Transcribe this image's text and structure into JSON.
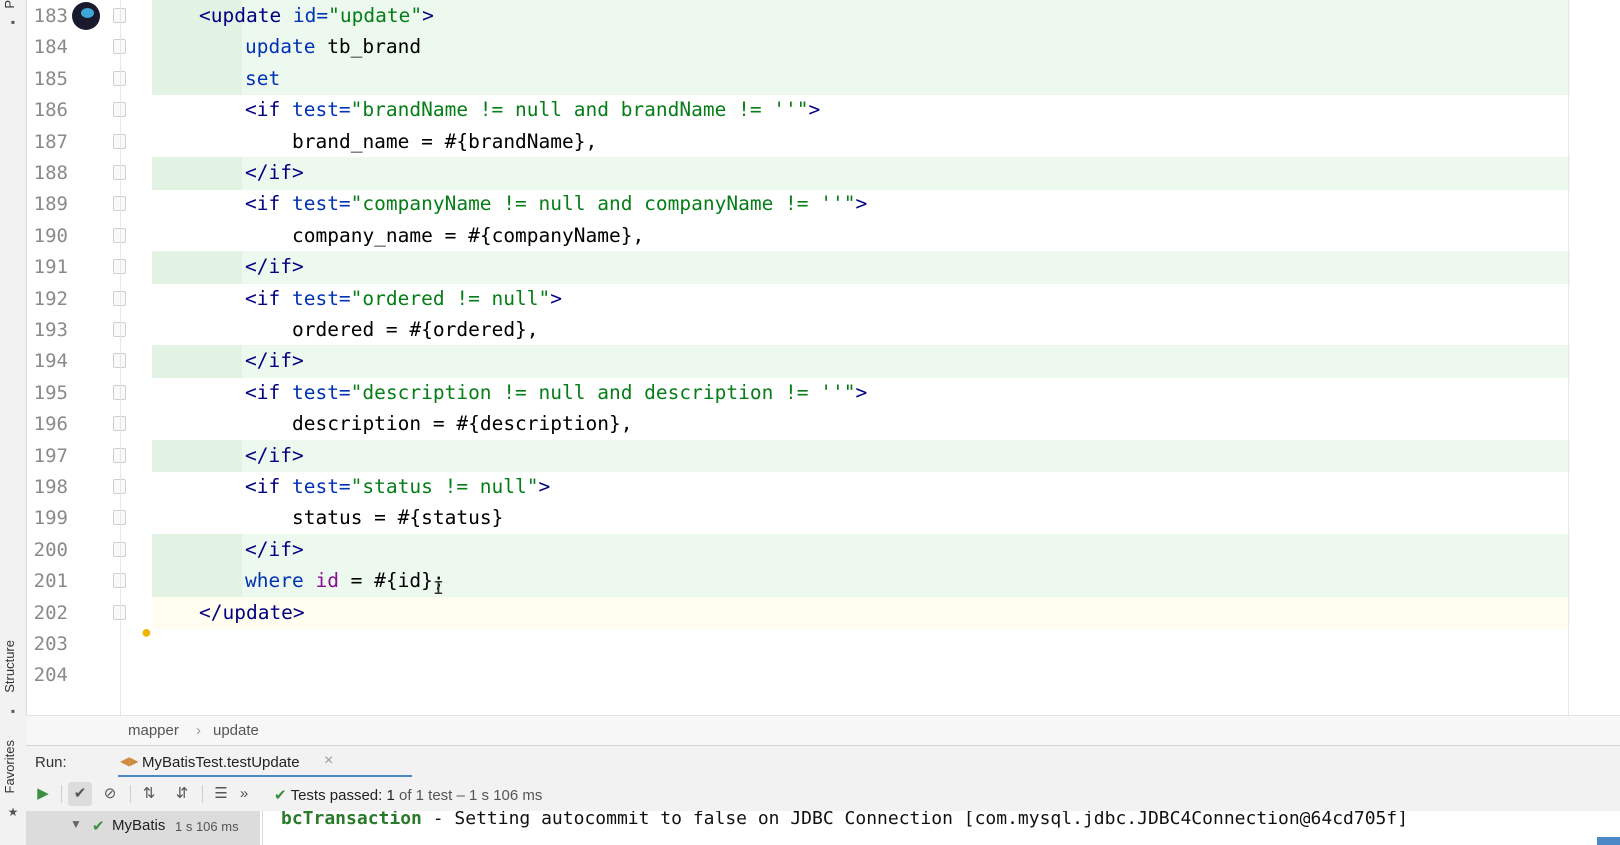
{
  "side": {
    "top_label": "P",
    "structure_label": "Structure",
    "favorites_label": "Favorites"
  },
  "editor": {
    "lines": [
      {
        "num": "183",
        "indent": 1,
        "tokens": [
          [
            "tag",
            "<update "
          ],
          [
            "attr",
            "id="
          ],
          [
            "str",
            "\"update\""
          ],
          [
            "tag",
            ">"
          ]
        ]
      },
      {
        "num": "184",
        "indent": 2,
        "tokens": [
          [
            "kw",
            "update"
          ],
          [
            "plain",
            " tb_brand"
          ]
        ]
      },
      {
        "num": "185",
        "indent": 2,
        "tokens": [
          [
            "kw",
            "set"
          ]
        ]
      },
      {
        "num": "186",
        "indent": 2,
        "tokens": [
          [
            "tag",
            "<if "
          ],
          [
            "attr",
            "test="
          ],
          [
            "str",
            "\"brandName != null and brandName != ''\""
          ],
          [
            "tag",
            ">"
          ]
        ]
      },
      {
        "num": "187",
        "indent": 3,
        "tokens": [
          [
            "plain",
            "brand_name = #{brandName},"
          ]
        ]
      },
      {
        "num": "188",
        "indent": 2,
        "tokens": [
          [
            "tag",
            "</if>"
          ]
        ]
      },
      {
        "num": "189",
        "indent": 2,
        "tokens": [
          [
            "tag",
            "<if "
          ],
          [
            "attr",
            "test="
          ],
          [
            "str",
            "\"companyName != null and companyName != ''\""
          ],
          [
            "tag",
            ">"
          ]
        ]
      },
      {
        "num": "190",
        "indent": 3,
        "tokens": [
          [
            "plain",
            "company_name = #{companyName},"
          ]
        ]
      },
      {
        "num": "191",
        "indent": 2,
        "tokens": [
          [
            "tag",
            "</if>"
          ]
        ]
      },
      {
        "num": "192",
        "indent": 2,
        "tokens": [
          [
            "tag",
            "<if "
          ],
          [
            "attr",
            "test="
          ],
          [
            "str",
            "\"ordered != null\""
          ],
          [
            "tag",
            ">"
          ]
        ]
      },
      {
        "num": "193",
        "indent": 3,
        "tokens": [
          [
            "plain",
            "ordered = #{ordered},"
          ]
        ]
      },
      {
        "num": "194",
        "indent": 2,
        "tokens": [
          [
            "tag",
            "</if>"
          ]
        ]
      },
      {
        "num": "195",
        "indent": 2,
        "tokens": [
          [
            "tag",
            "<if "
          ],
          [
            "attr",
            "test="
          ],
          [
            "str",
            "\"description != null and description != ''\""
          ],
          [
            "tag",
            ">"
          ]
        ]
      },
      {
        "num": "196",
        "indent": 3,
        "tokens": [
          [
            "plain",
            "description = #{description},"
          ]
        ]
      },
      {
        "num": "197",
        "indent": 2,
        "tokens": [
          [
            "tag",
            "</if>"
          ]
        ]
      },
      {
        "num": "198",
        "indent": 2,
        "tokens": [
          [
            "tag",
            "<if "
          ],
          [
            "attr",
            "test="
          ],
          [
            "str",
            "\"status != null\""
          ],
          [
            "tag",
            ">"
          ]
        ]
      },
      {
        "num": "199",
        "indent": 3,
        "tokens": [
          [
            "plain",
            "status = #{status}"
          ]
        ]
      },
      {
        "num": "200",
        "indent": 2,
        "tokens": [
          [
            "tag",
            "</if>"
          ]
        ]
      },
      {
        "num": "201",
        "indent": 2,
        "tokens": [
          [
            "kw",
            "where"
          ],
          [
            "plain",
            " "
          ],
          [
            "id",
            "id"
          ],
          [
            "plain",
            " = #{id};"
          ]
        ]
      },
      {
        "num": "202",
        "indent": 1,
        "tokens": [
          [
            "tag",
            "</update>"
          ]
        ]
      },
      {
        "num": "203",
        "indent": 0,
        "tokens": []
      },
      {
        "num": "204",
        "indent": 0,
        "tokens": []
      }
    ]
  },
  "breadcrumb": {
    "items": [
      "mapper",
      "update"
    ],
    "separator": "›"
  },
  "run": {
    "label": "Run:",
    "tab_label": "MyBatisTest.testUpdate",
    "close": "×"
  },
  "status": {
    "prefix": "Tests passed:",
    "passed": "1",
    "suffix": "of 1 test – 1 s 106 ms"
  },
  "tree": {
    "name": "MyBatis",
    "time": "1 s 106 ms"
  },
  "console": {
    "pkg": "bcTransaction",
    "rest": " - Setting autocommit to false on JDBC Connection [com.mysql.jdbc.JDBC4Connection@64cd705f]"
  },
  "colors": {
    "tag": "#000080",
    "attr": "#0033b3",
    "string": "#067d17",
    "keyword": "#0033b3",
    "field": "#871094",
    "highlight": "#edf8ee",
    "accent": "#4a88c7"
  }
}
